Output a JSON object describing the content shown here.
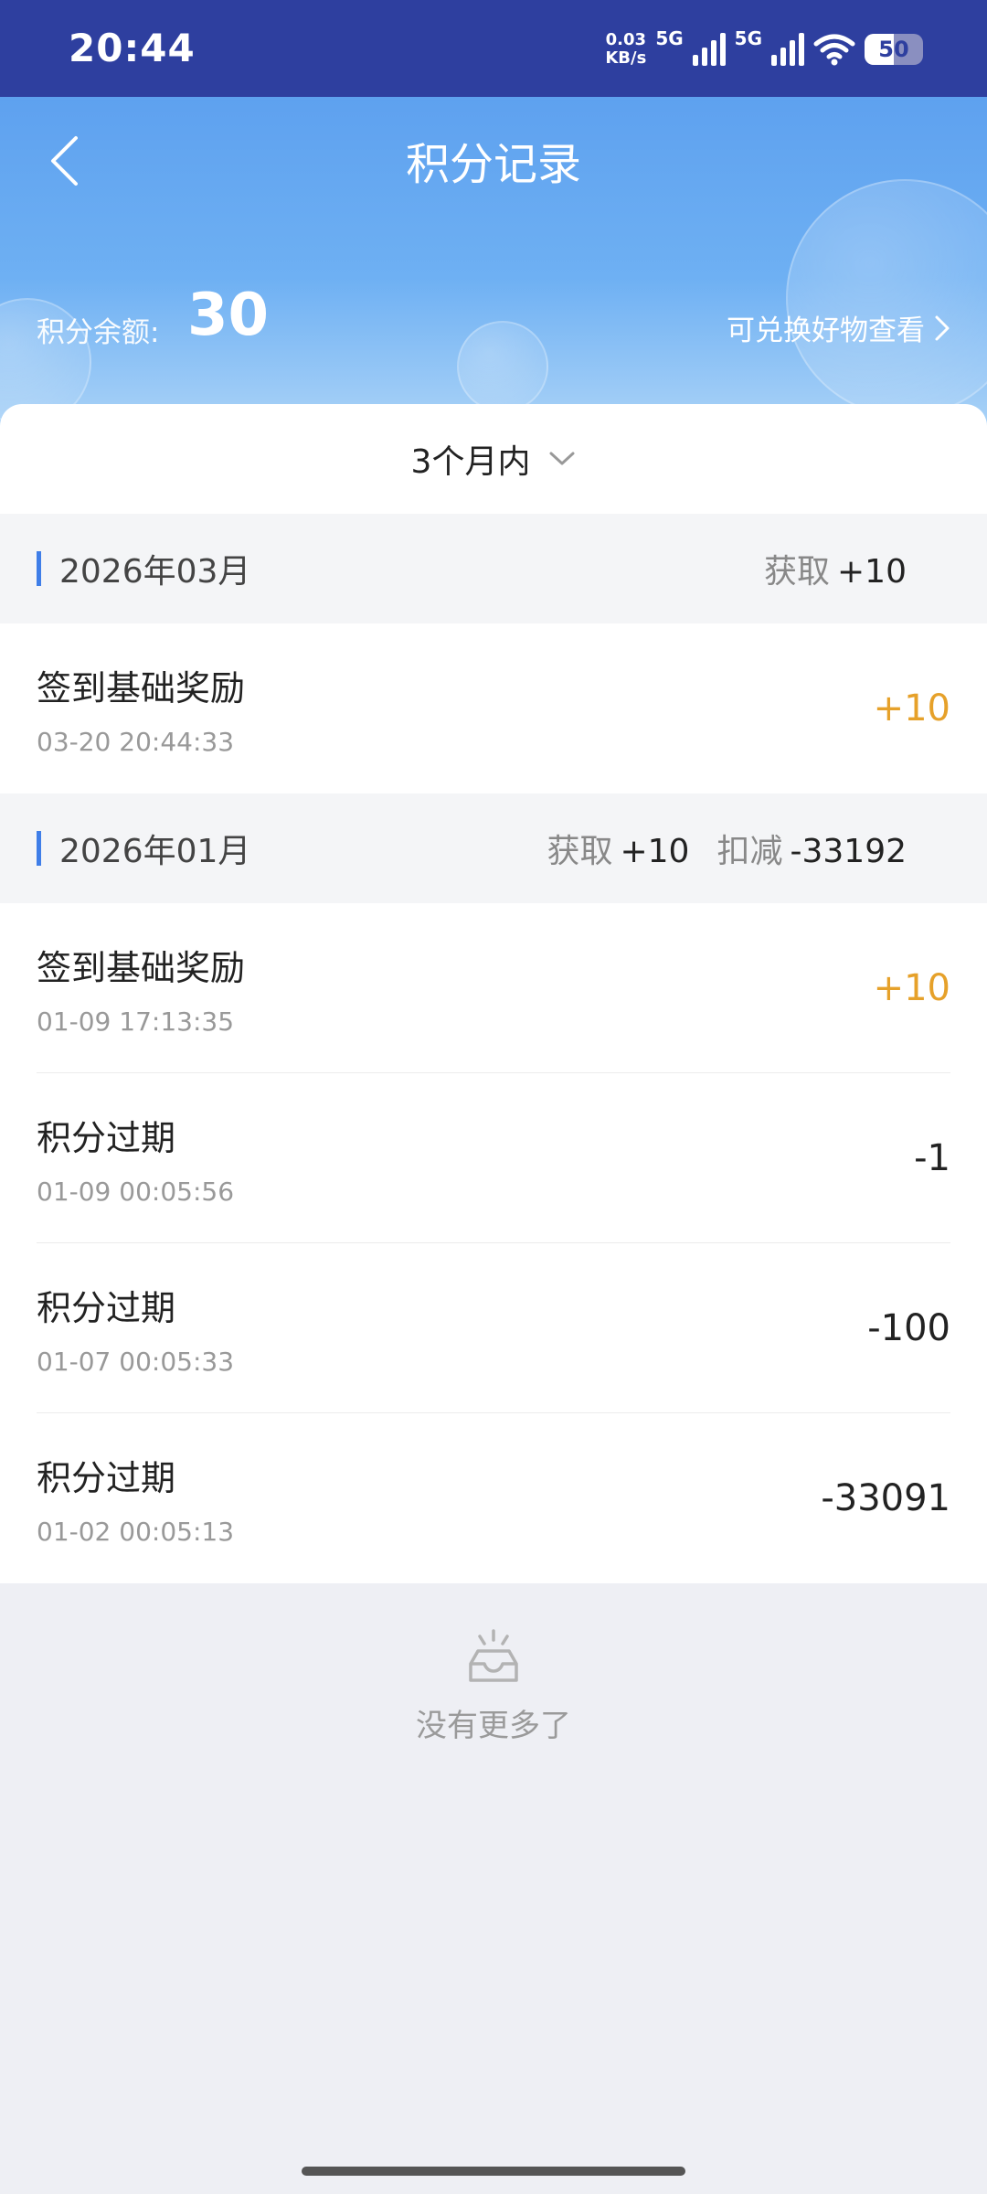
{
  "status_bar": {
    "time": "20:44",
    "net_speed_value": "0.03",
    "net_speed_unit": "KB/s",
    "signal_1_label": "5G",
    "signal_2_label": "5G",
    "battery": "50",
    "battery_level": 0.5
  },
  "header": {
    "title": "积分记录",
    "balance_label": "积分余额:",
    "balance_value": "30",
    "exchange_link": "可兑换好物查看"
  },
  "filter": {
    "label": "3个月内"
  },
  "groups": [
    {
      "month": "2026年03月",
      "gain_label": "获取",
      "gain_value": "+10",
      "records": [
        {
          "title": "签到基础奖励",
          "time": "03-20 20:44:33",
          "amount": "+10",
          "positive": true
        }
      ]
    },
    {
      "month": "2026年01月",
      "gain_label": "获取",
      "gain_value": "+10",
      "deduct_label": "扣减",
      "deduct_value": "-33192",
      "records": [
        {
          "title": "签到基础奖励",
          "time": "01-09 17:13:35",
          "amount": "+10",
          "positive": true
        },
        {
          "title": "积分过期",
          "time": "01-09 00:05:56",
          "amount": "-1",
          "positive": false
        },
        {
          "title": "积分过期",
          "time": "01-07 00:05:33",
          "amount": "-100",
          "positive": false
        },
        {
          "title": "积分过期",
          "time": "01-02 00:05:13",
          "amount": "-33091",
          "positive": false
        }
      ]
    }
  ],
  "footer": {
    "no_more_text": "没有更多了"
  },
  "colors": {
    "status_bar_bg": "#2e3f9f",
    "accent_blue": "#3f7ee8",
    "positive_amount": "#e6a12a"
  }
}
